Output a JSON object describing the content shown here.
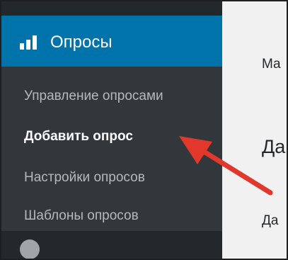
{
  "menu": {
    "active_label": "Опросы",
    "active_icon": "bar-chart-icon",
    "submenu": [
      {
        "label": "Управление опросами",
        "current": false
      },
      {
        "label": "Добавить опрос",
        "current": true
      },
      {
        "label": "Настройки опросов",
        "current": false
      },
      {
        "label": "Шаблоны опросов",
        "current": false
      }
    ],
    "next_item_icon": "circle-icon"
  },
  "content": {
    "line1": "Ма",
    "heading": "Да",
    "line2": "Да"
  },
  "colors": {
    "sidebar_bg": "#23282d",
    "submenu_bg": "#32373c",
    "active_bg": "#0073aa",
    "submenu_text": "#b4b9be",
    "current_text": "#ffffff",
    "annotation_arrow": "#e2372b"
  }
}
